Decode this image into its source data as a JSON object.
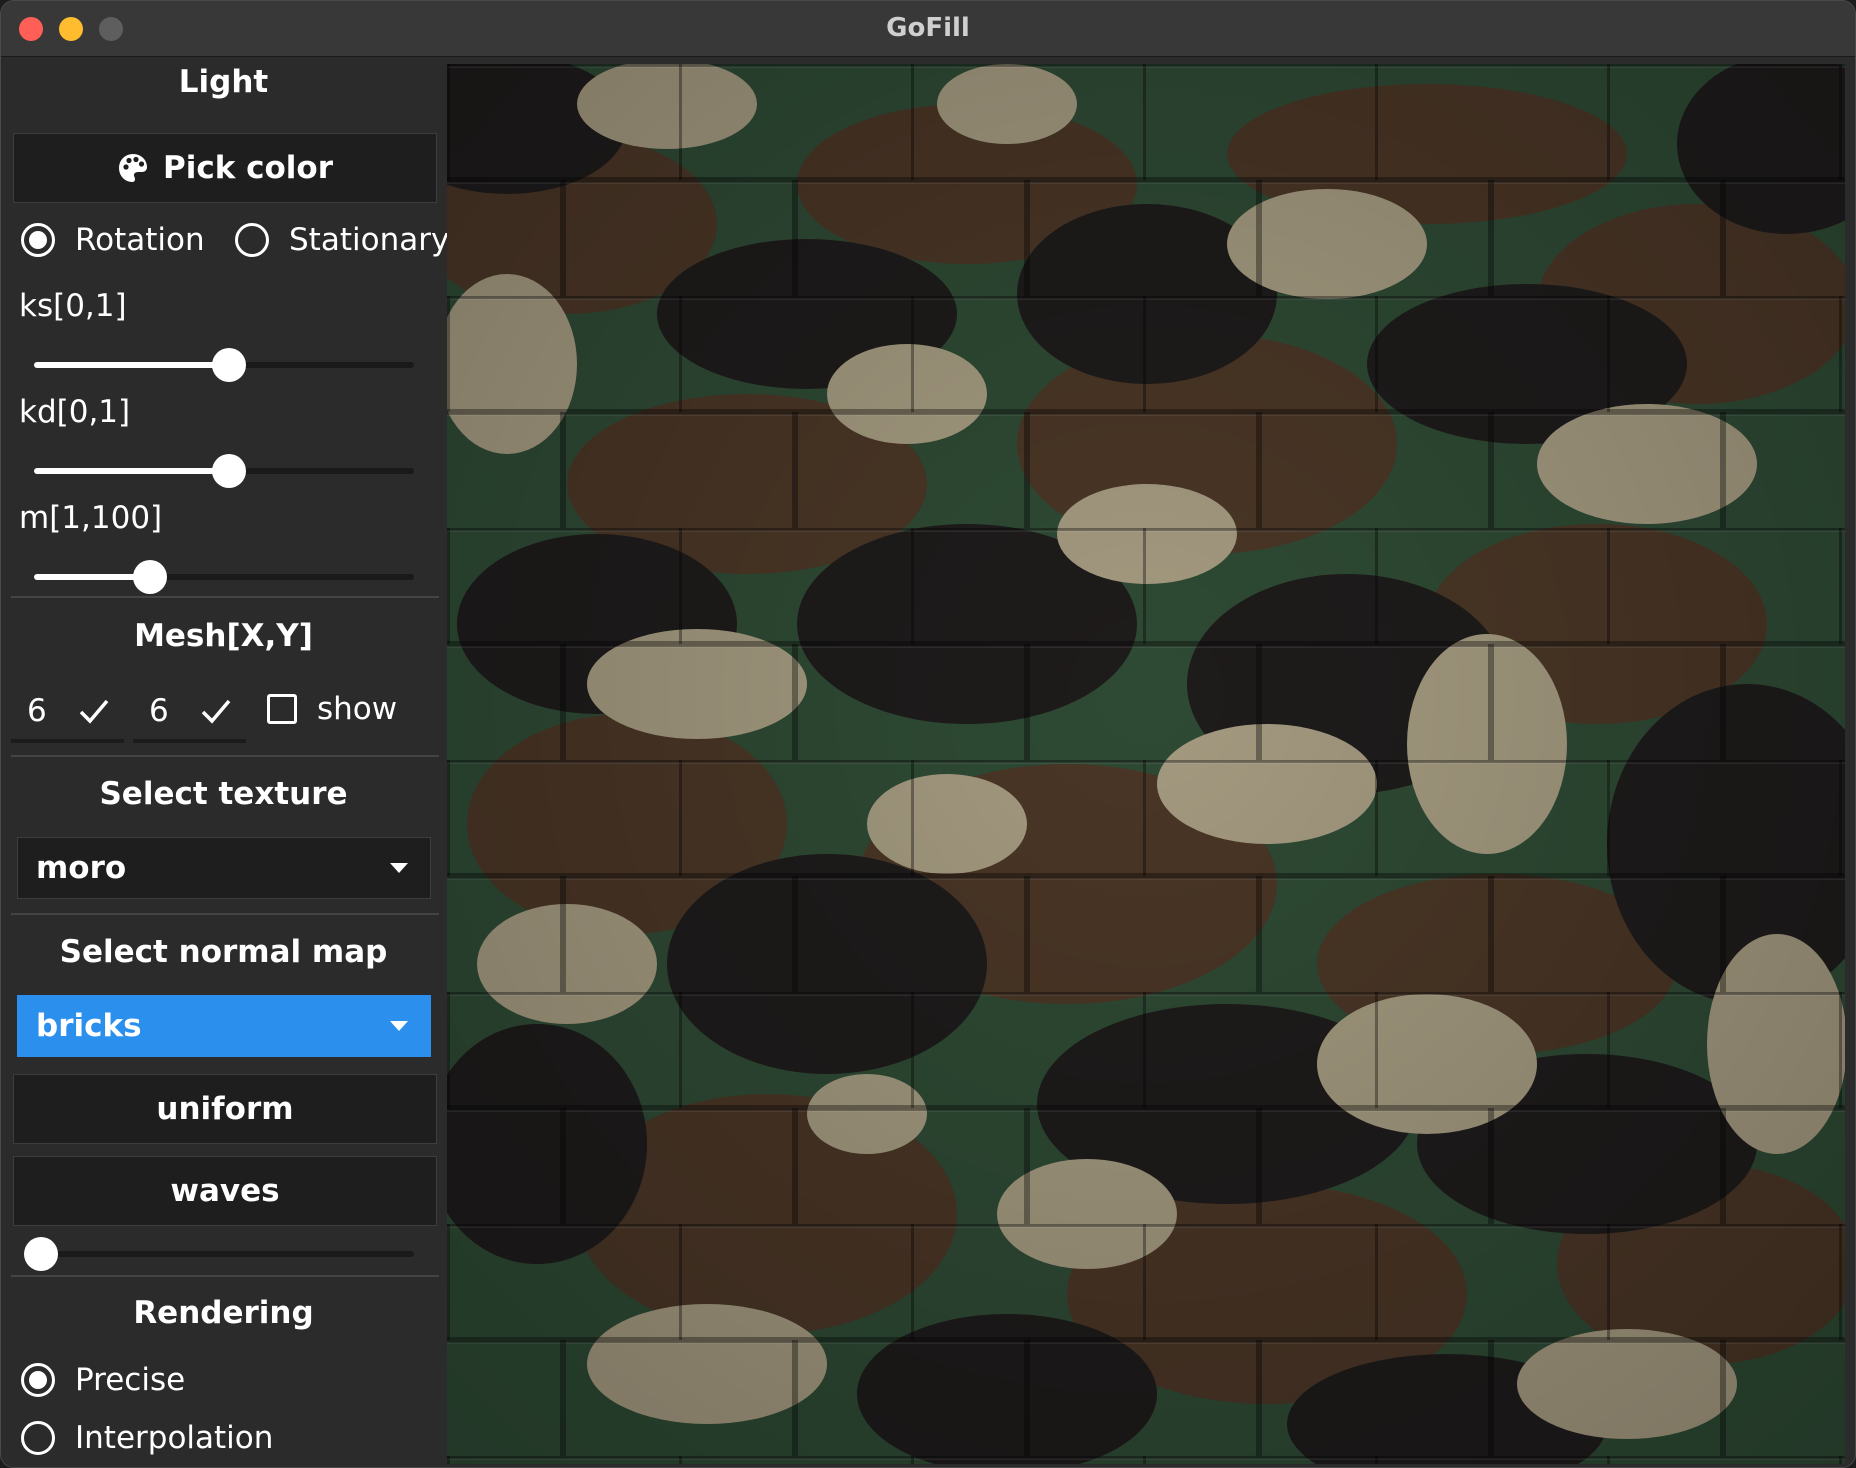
{
  "window": {
    "title": "GoFill"
  },
  "light": {
    "heading": "Light",
    "pick_color_label": "Pick color",
    "mode_options": [
      {
        "label": "Rotation",
        "selected": true
      },
      {
        "label": "Stationary",
        "selected": false
      }
    ],
    "sliders": [
      {
        "label": "ks[0,1]",
        "value": 0.5
      },
      {
        "label": "kd[0,1]",
        "value": 0.5
      },
      {
        "label": "m[1,100]",
        "value": 30
      }
    ]
  },
  "mesh": {
    "heading": "Mesh[X,Y]",
    "x_value": "6",
    "y_value": "6",
    "show_label": "show",
    "show_checked": false
  },
  "texture": {
    "heading": "Select texture",
    "selected": "moro"
  },
  "normal_map": {
    "heading": "Select normal map",
    "selected": "bricks",
    "uniform_label": "uniform",
    "waves_label": "waves",
    "waves_slider_value": 0
  },
  "rendering": {
    "heading": "Rendering",
    "options": [
      {
        "label": "Precise",
        "selected": true
      },
      {
        "label": "Interpolation",
        "selected": false
      }
    ]
  },
  "colors": {
    "accent": "#2b8fed",
    "panel": "#2b2b2b",
    "camo_tan": "#a49a80",
    "camo_green": "#2e4e36",
    "camo_brown": "#4a3626",
    "camo_black": "#1e1b1b"
  },
  "icons": {
    "pick_color": "palette-icon",
    "entry_confirm": "checkmark-icon",
    "select_caret": "caret-down-icon"
  }
}
